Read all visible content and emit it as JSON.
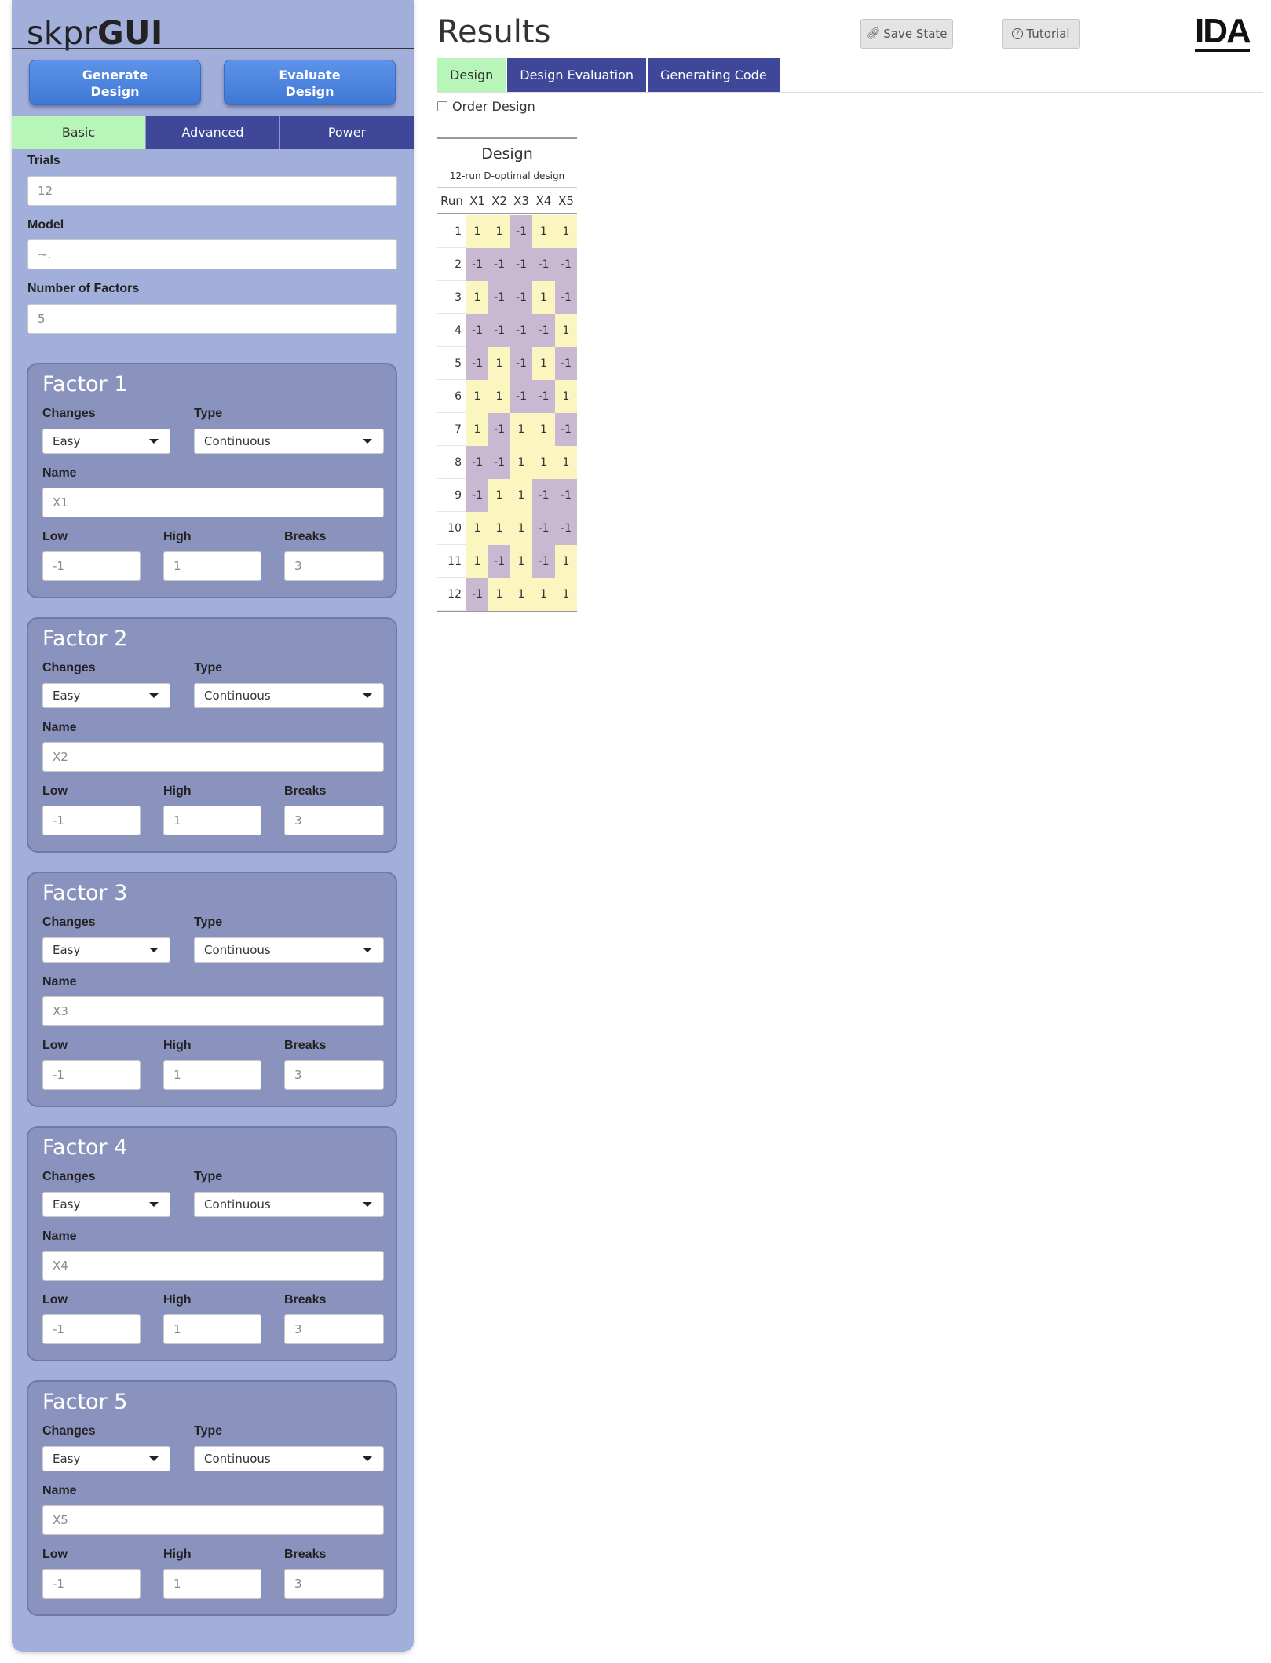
{
  "app": {
    "title_prefix": "skpr",
    "title_bold": "GUI"
  },
  "buttons": {
    "generate": "Generate Design",
    "generate_l1": "Generate",
    "generate_l2": "Design",
    "evaluate_l1": "Evaluate",
    "evaluate_l2": "Design"
  },
  "sidebar_tabs": [
    "Basic",
    "Advanced",
    "Power"
  ],
  "basic": {
    "trials_label": "Trials",
    "trials_value": "12",
    "model_label": "Model",
    "model_value": "~.",
    "nfactors_label": "Number of Factors",
    "nfactors_value": "5"
  },
  "factor_labels": {
    "changes": "Changes",
    "type": "Type",
    "name": "Name",
    "low": "Low",
    "high": "High",
    "breaks": "Breaks"
  },
  "factors": [
    {
      "title": "Factor 1",
      "changes": "Easy",
      "type": "Continuous",
      "name": "X1",
      "low": "-1",
      "high": "1",
      "breaks": "3"
    },
    {
      "title": "Factor 2",
      "changes": "Easy",
      "type": "Continuous",
      "name": "X2",
      "low": "-1",
      "high": "1",
      "breaks": "3"
    },
    {
      "title": "Factor 3",
      "changes": "Easy",
      "type": "Continuous",
      "name": "X3",
      "low": "-1",
      "high": "1",
      "breaks": "3"
    },
    {
      "title": "Factor 4",
      "changes": "Easy",
      "type": "Continuous",
      "name": "X4",
      "low": "-1",
      "high": "1",
      "breaks": "3"
    },
    {
      "title": "Factor 5",
      "changes": "Easy",
      "type": "Continuous",
      "name": "X5",
      "low": "-1",
      "high": "1",
      "breaks": "3"
    }
  ],
  "main": {
    "title": "Results",
    "save_state": "Save State",
    "tutorial": "Tutorial",
    "logo": "IDA",
    "tabs": [
      "Design",
      "Design Evaluation",
      "Generating Code"
    ],
    "order_design": "Order Design"
  },
  "design_table": {
    "title": "Design",
    "subtitle": "12-run D-optimal design",
    "columns": [
      "Run",
      "X1",
      "X2",
      "X3",
      "X4",
      "X5"
    ],
    "rows": [
      [
        "1",
        "1",
        "1",
        "-1",
        "1",
        "1"
      ],
      [
        "2",
        "-1",
        "-1",
        "-1",
        "-1",
        "-1"
      ],
      [
        "3",
        "1",
        "-1",
        "-1",
        "1",
        "-1"
      ],
      [
        "4",
        "-1",
        "-1",
        "-1",
        "-1",
        "1"
      ],
      [
        "5",
        "-1",
        "1",
        "-1",
        "1",
        "-1"
      ],
      [
        "6",
        "1",
        "1",
        "-1",
        "-1",
        "1"
      ],
      [
        "7",
        "1",
        "-1",
        "1",
        "1",
        "-1"
      ],
      [
        "8",
        "-1",
        "-1",
        "1",
        "1",
        "1"
      ],
      [
        "9",
        "-1",
        "1",
        "1",
        "-1",
        "-1"
      ],
      [
        "10",
        "1",
        "1",
        "1",
        "-1",
        "-1"
      ],
      [
        "11",
        "1",
        "-1",
        "1",
        "-1",
        "1"
      ],
      [
        "12",
        "-1",
        "1",
        "1",
        "1",
        "1"
      ]
    ],
    "colors": {
      "positive": "#fbf6bf",
      "negative": "#c8b8d2"
    }
  },
  "colors": {
    "sidebar": "#a3afdb",
    "factor_panel": "#8993be",
    "tab_active": "#b8f5b8",
    "tab": "#3f4898",
    "button": "#4a84e0"
  }
}
